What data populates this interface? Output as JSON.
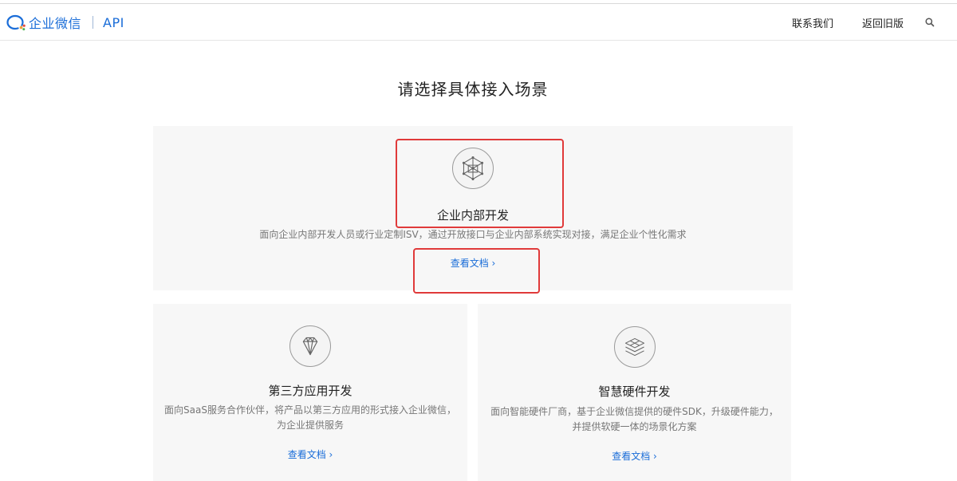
{
  "header": {
    "brand_name": "企业微信",
    "brand_suffix": "API",
    "nav": {
      "contact": "联系我们",
      "old_version": "返回旧版"
    }
  },
  "page": {
    "title": "请选择具体接入场景"
  },
  "cards": {
    "internal": {
      "title": "企业内部开发",
      "desc": "面向企业内部开发人员或行业定制ISV，通过开放接口与企业内部系统实现对接，满足企业个性化需求",
      "link": "查看文档 ›",
      "icon": "cube-network-icon"
    },
    "third_party": {
      "title": "第三方应用开发",
      "desc_line1": "面向SaaS服务合作伙伴，将产品以第三方应用的形式接入企业微信，",
      "desc_line2": "为企业提供服务",
      "link": "查看文档 ›",
      "icon": "diamond-icon"
    },
    "hardware": {
      "title": "智慧硬件开发",
      "desc_line1": "面向智能硬件厂商，基于企业微信提供的硬件SDK，升级硬件能力，",
      "desc_line2": "并提供软硬一体的场景化方案",
      "link": "查看文档 ›",
      "icon": "layers-icon"
    }
  },
  "colors": {
    "brand": "#1a6dd8",
    "highlight": "#e03a3a",
    "card_bg": "#f7f7f7"
  }
}
